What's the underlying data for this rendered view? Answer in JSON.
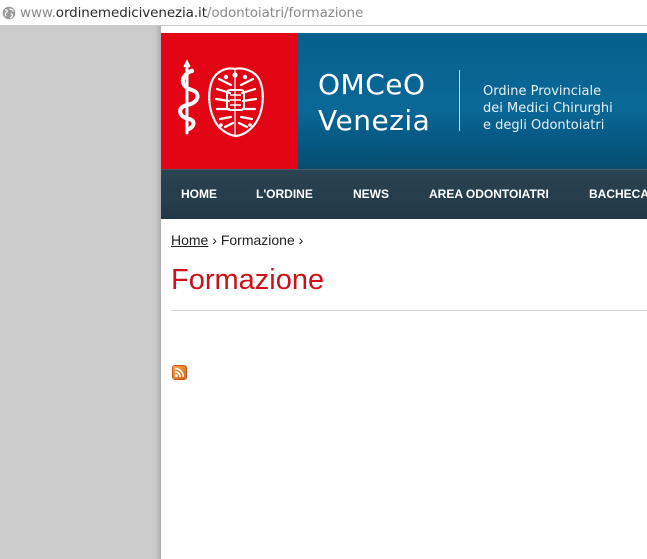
{
  "browser": {
    "url_scheme": "www.",
    "url_host": "ordinemedicivenezia.it",
    "url_path": "/odontoiatri/formazione",
    "icons": {
      "site_info": "globe-icon"
    }
  },
  "header": {
    "logo_icon": "omceo-venezia-logo",
    "site_name_line1": "OMCeO",
    "site_name_line2": "Venezia",
    "org_line1": "Ordine Provinciale",
    "org_line2": "dei Medici Chirurghi",
    "org_line3": "e degli Odontoiatri",
    "colors": {
      "logo_red": "#e30513",
      "header_blue": "#0a6897"
    }
  },
  "nav": {
    "items": [
      {
        "label": "HOME"
      },
      {
        "label": "L'ORDINE"
      },
      {
        "label": "NEWS"
      },
      {
        "label": "AREA ODONTOIATRI"
      },
      {
        "label": "BACHECA"
      }
    ],
    "colors": {
      "background": "#263d4b",
      "text": "#ffffff"
    }
  },
  "breadcrumb": {
    "home": "Home",
    "sep1": "›",
    "current": "Formazione",
    "sep2": "›"
  },
  "main": {
    "title": "Formazione",
    "rss_icon": "rss-feed-icon",
    "colors": {
      "title": "#cc1118"
    }
  }
}
